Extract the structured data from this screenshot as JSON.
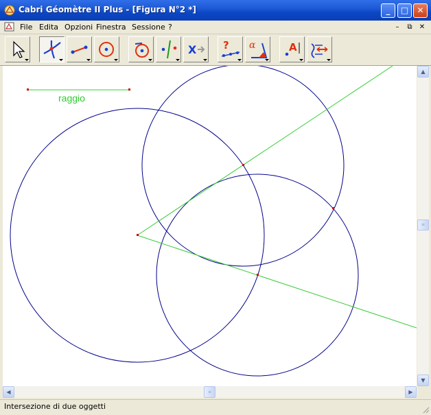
{
  "window": {
    "title": "Cabri Géomètre II Plus - [Figura N°2 *]",
    "controls": {
      "minimize": "_",
      "maximize": "□",
      "close": "✕"
    }
  },
  "menu": {
    "items": [
      {
        "label": "File",
        "accesskey": "F"
      },
      {
        "label": "Edita",
        "accesskey": "E"
      },
      {
        "label": "Opzioni",
        "accesskey": "O"
      },
      {
        "label": "Finestra",
        "accesskey": "n"
      },
      {
        "label": "Sessione",
        "accesskey": "S"
      },
      {
        "label": "?",
        "accesskey": "?"
      }
    ],
    "mdi": {
      "minimize": "–",
      "restore": "⧉",
      "close": "✕"
    }
  },
  "toolbar": {
    "tools": [
      {
        "name": "pointer-tool",
        "icon": "arrow-pointer-icon",
        "active": false
      },
      {
        "name": "points-tool",
        "icon": "intersection-point-icon",
        "active": true
      },
      {
        "name": "lines-tool",
        "icon": "segment-icon",
        "active": false
      },
      {
        "name": "curves-tool",
        "icon": "circle-icon",
        "active": false
      },
      {
        "name": "constructions-tool",
        "icon": "compass-circle-icon",
        "active": false
      },
      {
        "name": "transformations-tool",
        "icon": "reflection-icon",
        "active": false
      },
      {
        "name": "macro-tool",
        "icon": "macro-x-icon",
        "active": false
      },
      {
        "name": "properties-tool",
        "icon": "collinear-question-icon",
        "active": false
      },
      {
        "name": "measure-tool",
        "icon": "angle-alpha-icon",
        "active": false
      },
      {
        "name": "display-tool",
        "icon": "text-label-icon",
        "active": false
      },
      {
        "name": "drawing-tool",
        "icon": "hide-show-icon",
        "active": false
      }
    ]
  },
  "canvas": {
    "segment_label": "raggio",
    "colors": {
      "circle": "#00008b",
      "line": "#33cc33",
      "point": "#cc0000",
      "label": "#2ecc2e"
    }
  },
  "scrollbars": {
    "up": "▲",
    "down": "▼",
    "left": "◀",
    "right": "▶",
    "grip": "≡"
  },
  "status": {
    "text": "Intersezione di due oggetti"
  }
}
